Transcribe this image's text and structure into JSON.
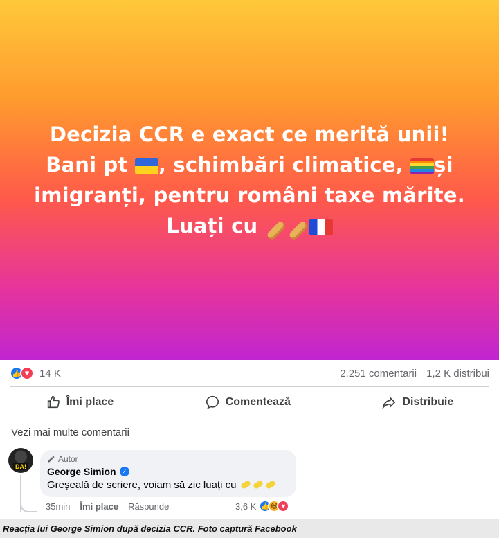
{
  "post": {
    "banner_line1": "Decizia CCR e exact ce merită unii!",
    "banner_line2_prefix": "Bani pt",
    "banner_line2_suffix": ", schimbări climatice,",
    "banner_line3_prefix": "și",
    "banner_line3_rest": "imigranți, pentru români taxe mărite.",
    "banner_line4": "Luați cu",
    "banner_gradient": [
      "#ffc83a",
      "#ff9a2e",
      "#ff5a4a",
      "#e6349c",
      "#c025d0"
    ],
    "icons": [
      "flag-ukraine",
      "rainbow-flag",
      "baguette",
      "baguette",
      "flag-france"
    ]
  },
  "stats": {
    "reaction_count": "14 K",
    "comments": "2.251 comentarii",
    "shares": "1,2 K distribui"
  },
  "actions": {
    "like": "Îmi place",
    "comment": "Comentează",
    "share": "Distribuie"
  },
  "comments_section": {
    "view_more": "Vezi mai multe comentarii"
  },
  "comment": {
    "author_tag": "Autor",
    "author_name": "George Simion",
    "avatar_text": "DA!",
    "text": "Greșeală de scriere, voiam să zic luați cu",
    "time": "35min",
    "like": "Îmi place",
    "reply": "Răspunde",
    "reaction_count": "3,6 K"
  },
  "caption": "Reacția lui George Simion după decizia CCR. Foto captură Facebook",
  "colors": {
    "facebook_blue": "#1877f2",
    "love_red": "#f33e58",
    "haha_yellow": "#f7b125"
  }
}
